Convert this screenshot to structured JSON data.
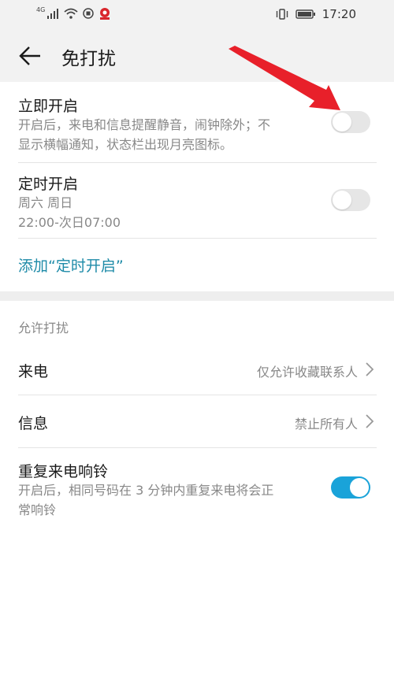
{
  "status_bar": {
    "network_label": "4G",
    "time": "17:20"
  },
  "header": {
    "title": "免打扰"
  },
  "immediate": {
    "title": "立即开启",
    "description_line1": "开启后，来电和信息提醒静音，闹钟除外；不",
    "description_line2": "显示横幅通知，状态栏出现月亮图标。",
    "enabled": false
  },
  "scheduled": {
    "title": "定时开启",
    "days": "周六 周日",
    "time_range": "22:00-次日07:00",
    "enabled": false
  },
  "add_schedule": {
    "label": "添加“定时开启”"
  },
  "allow_section": {
    "header": "允许打扰",
    "calls": {
      "label": "来电",
      "value": "仅允许收藏联系人"
    },
    "messages": {
      "label": "信息",
      "value": "禁止所有人"
    },
    "repeat_calls": {
      "title": "重复来电响铃",
      "description_line1": "开启后，相同号码在 3 分钟内重复来电将会正",
      "description_line2": "常响铃",
      "enabled": true
    }
  },
  "colors": {
    "accent": "#1aa3d9",
    "link": "#1e8ba8",
    "annotation_arrow": "#e8202a",
    "toggle_off": "#e6e6e6"
  }
}
